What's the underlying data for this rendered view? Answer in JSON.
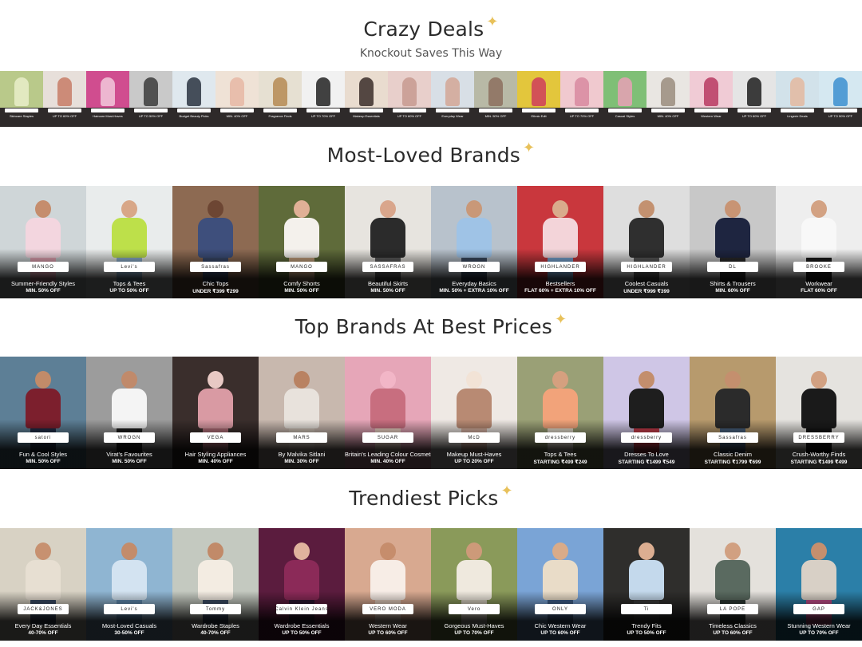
{
  "sections": {
    "crazy_deals": {
      "title": "Crazy Deals",
      "subtitle": "Knockout Saves This Way"
    },
    "most_loved": {
      "title": "Most-Loved Brands"
    },
    "top_brands": {
      "title": "Top Brands At Best Prices"
    },
    "trendiest": {
      "title": "Trendiest Picks"
    }
  },
  "sparkle_icon": "✦",
  "deal_tiles": [
    {
      "top": "#b9c98a",
      "fig": "#e9efc9"
    },
    {
      "top": "#e7dfda",
      "fig": "#c77d66"
    },
    {
      "top": "#d04d8f",
      "fig": "#f2c9dc"
    },
    {
      "top": "#c9c9c9",
      "fig": "#3b3b3b"
    },
    {
      "top": "#dfe8ee",
      "fig": "#2a3240"
    },
    {
      "top": "#efe2d6",
      "fig": "#e6b7a4"
    },
    {
      "top": "#e6e0d2",
      "fig": "#b58a53"
    },
    {
      "top": "#f1f1f1",
      "fig": "#222"
    },
    {
      "top": "#e9dccf",
      "fig": "#3a2d29"
    },
    {
      "top": "#e8cfcb",
      "fig": "#c79a91"
    },
    {
      "top": "#d8dfe6",
      "fig": "#d3a795"
    },
    {
      "top": "#b8b9a6",
      "fig": "#8c6f5e"
    },
    {
      "top": "#e3c63c",
      "fig": "#cf3d5c"
    },
    {
      "top": "#f0c9cf",
      "fig": "#d88aa0"
    },
    {
      "top": "#7fbf76",
      "fig": "#e7a0b6"
    },
    {
      "top": "#e9e6e2",
      "fig": "#9a8c7e"
    },
    {
      "top": "#f0cbd5",
      "fig": "#b93a62"
    },
    {
      "top": "#e5e5e5",
      "fig": "#1f1f1f"
    },
    {
      "top": "#d2e2ea",
      "fig": "#e4b8a0"
    },
    {
      "top": "#d5e8f1",
      "fig": "#3c8fd0"
    }
  ],
  "deal_texts": [
    "Skincare Staples",
    "UP TO 60% OFF",
    "Haircare Must-Haves",
    "UP TO 50% OFF",
    "Budget Beauty Picks",
    "MIN. 40% OFF",
    "Fragrance Finds",
    "UP TO 70% OFF",
    "Makeup Essentials",
    "UP TO 60% OFF",
    "Everyday Wear",
    "MIN. 50% OFF",
    "Ethnic Edit",
    "UP TO 70% OFF",
    "Casual Styles",
    "MIN. 40% OFF",
    "Western Wear",
    "UP TO 60% OFF",
    "Lingerie Deals",
    "UP TO 50% OFF"
  ],
  "most_loved_cards": [
    {
      "logo": "MANGO",
      "title": "Summer-Friendly Styles",
      "offer": "MIN. 50% OFF",
      "bg": "#cfd6d8",
      "top": "#f3d6df",
      "bottom": "#e9a8b8",
      "skin": "#c58d6d"
    },
    {
      "logo": "Levi's",
      "title": "Tops & Tees",
      "offer": "UP TO 50% OFF",
      "bg": "#e9ecec",
      "top": "#bde04a",
      "bottom": "#8fb2d0",
      "skin": "#d8a788"
    },
    {
      "logo": "Sassafras",
      "title": "Chic Tops",
      "offer": "UNDER ₹399 ₹299",
      "bg": "#8d6a52",
      "top": "#3e4f7c",
      "bottom": "#3b4a6a",
      "skin": "#6d4633"
    },
    {
      "logo": "MANGO",
      "title": "Comfy Shorts",
      "offer": "MIN. 50% OFF",
      "bg": "#5f6b3a",
      "top": "#f4f1ec",
      "bottom": "#c9a57f",
      "skin": "#e0b096"
    },
    {
      "logo": "SASSAFRAS",
      "title": "Beautiful Skirts",
      "offer": "MIN. 50% OFF",
      "bg": "#e7e4df",
      "top": "#2b2b2b",
      "bottom": "#5d5d5d",
      "skin": "#d9a68c"
    },
    {
      "logo": "WROGN",
      "title": "Everyday Basics",
      "offer": "MIN. 50% + EXTRA 10% OFF",
      "bg": "#b8c2cc",
      "top": "#9fc3e6",
      "bottom": "#3c4c63",
      "skin": "#c99878"
    },
    {
      "logo": "HIGHLANDER",
      "title": "Bestsellers",
      "offer": "FLAT 60% + EXTRA 10% OFF",
      "bg": "#c9373d",
      "top": "#f3d4d9",
      "bottom": "#7aa7d6",
      "skin": "#d9ab8c"
    },
    {
      "logo": "HIGHLANDER",
      "title": "Coolest Casuals",
      "offer": "UNDER ₹999 ₹399",
      "bg": "#dedede",
      "top": "#2f2f2f",
      "bottom": "#5a5a5a",
      "skin": "#c39170"
    },
    {
      "logo": "DL",
      "title": "Shirts & Trousers",
      "offer": "MIN. 60% OFF",
      "bg": "#c8c8c8",
      "top": "#1e2540",
      "bottom": "#2a2a2a",
      "skin": "#c89474"
    },
    {
      "logo": "BROOKE",
      "title": "Workwear",
      "offer": "FLAT 60% OFF",
      "bg": "#eeeeee",
      "top": "#f8f8f8",
      "bottom": "#1c1c1c",
      "skin": "#d3a283"
    }
  ],
  "top_brand_cards": [
    {
      "logo": "satori",
      "title": "Fun & Cool Styles",
      "offer": "MIN. 50% OFF",
      "bg": "#5d7f96",
      "top": "#7c1f2d",
      "bottom": "#1f2d46",
      "skin": "#c28b69"
    },
    {
      "logo": "WROGN",
      "title": "Virat's Favourites",
      "offer": "MIN. 50% OFF",
      "bg": "#9c9c9c",
      "top": "#f4f4f4",
      "bottom": "#1c1c1c",
      "skin": "#c08a6b"
    },
    {
      "logo": "VEGA",
      "title": "Hair Styling Appliances",
      "offer": "MIN. 40% OFF",
      "bg": "#3a2e2c",
      "top": "#d99aa3",
      "bottom": "#b46f79",
      "skin": "#e8c9c4"
    },
    {
      "logo": "MARS",
      "title": "By Malvika Sitlani",
      "offer": "MIN. 30% OFF",
      "bg": "#c8b8ae",
      "top": "#e8e2dc",
      "bottom": "#d0c4b8",
      "skin": "#b98262"
    },
    {
      "logo": "SUGAR",
      "title": "Britain's Leading Colour Cosmetics",
      "offer": "MIN. 40% OFF",
      "bg": "#e6a6b8",
      "top": "#c86e7f",
      "bottom": "#f0d7c8",
      "skin": "#f2b6c7"
    },
    {
      "logo": "McD",
      "title": "Makeup Must-Haves",
      "offer": "UP TO 20% OFF",
      "bg": "#efe9e4",
      "top": "#b88a73",
      "bottom": "#d8b2a2",
      "skin": "#f2e3d6"
    },
    {
      "logo": "dressberry",
      "title": "Tops & Tees",
      "offer": "STARTING ₹499 ₹249",
      "bg": "#9aa076",
      "top": "#f2a37a",
      "bottom": "#e9e2d2",
      "skin": "#d5a07f"
    },
    {
      "logo": "dressberry",
      "title": "Dresses To Love",
      "offer": "STARTING ₹1499 ₹549",
      "bg": "#cfc6e6",
      "top": "#1e1e1e",
      "bottom": "#c93c4a",
      "skin": "#c38e6d"
    },
    {
      "logo": "Sassafras",
      "title": "Classic Denim",
      "offer": "STARTING ₹1799 ₹699",
      "bg": "#b79a6d",
      "top": "#2b2b2b",
      "bottom": "#48617e",
      "skin": "#c48f6e"
    },
    {
      "logo": "DRESSBERRY",
      "title": "Crush-Worthy Finds",
      "offer": "STARTING ₹1499 ₹499",
      "bg": "#e5e3df",
      "top": "#1a1a1a",
      "bottom": "#141414",
      "skin": "#d2a182"
    }
  ],
  "trendiest_cards": [
    {
      "logo": "JACK&JONES",
      "title": "Every Day Essentials",
      "offer": "40-70% OFF",
      "bg": "#d8d2c4",
      "top": "#e7dfd2",
      "bottom": "#3b4d66",
      "skin": "#c79170"
    },
    {
      "logo": "Levi's",
      "title": "Most-Loved Casuals",
      "offer": "30-50% OFF",
      "bg": "#8fb5d2",
      "top": "#d3e3f1",
      "bottom": "#5f8ab0",
      "skin": "#c38c6b"
    },
    {
      "logo": "Tommy",
      "title": "Wardrobe Staples",
      "offer": "40-70% OFF",
      "bg": "#c4c9c0",
      "top": "#f3ece2",
      "bottom": "#3e5067",
      "skin": "#c18a69"
    },
    {
      "logo": "Calvin Klein Jeans",
      "title": "Wardrobe Essentials",
      "offer": "UP TO 50% OFF",
      "bg": "#5b1c3e",
      "top": "#8b2a58",
      "bottom": "#2c1630",
      "skin": "#e0b39d"
    },
    {
      "logo": "VERO MODA",
      "title": "Western Wear",
      "offer": "UP TO 60% OFF",
      "bg": "#d8a990",
      "top": "#f7ede6",
      "bottom": "#e3cdbd",
      "skin": "#c68d6c"
    },
    {
      "logo": "Vero",
      "title": "Gorgeous Must-Haves",
      "offer": "UP TO 70% OFF",
      "bg": "#8a9a5a",
      "top": "#efe9de",
      "bottom": "#d9d2c1",
      "skin": "#cd9a79"
    },
    {
      "logo": "ONLY",
      "title": "Chic Western Wear",
      "offer": "UP TO 60% OFF",
      "bg": "#7aa4d6",
      "top": "#e9dcc8",
      "bottom": "#40608c",
      "skin": "#d9ab89"
    },
    {
      "logo": "Ti",
      "title": "Trendy Fits",
      "offer": "UP TO 50% OFF",
      "bg": "#2f2e2c",
      "top": "#c4d9ec",
      "bottom": "#3a3a3a",
      "skin": "#dcae91"
    },
    {
      "logo": "LA POPE",
      "title": "Timeless Classics",
      "offer": "UP TO 60% OFF",
      "bg": "#e4e1dc",
      "top": "#5a6a60",
      "bottom": "#2e3b35",
      "skin": "#d1a081"
    },
    {
      "logo": "GAP",
      "title": "Stunning Western Wear",
      "offer": "UP TO 70% OFF",
      "bg": "#2b7fa8",
      "top": "#d8d0c6",
      "bottom": "#c24f8a",
      "skin": "#c58f6e"
    }
  ]
}
